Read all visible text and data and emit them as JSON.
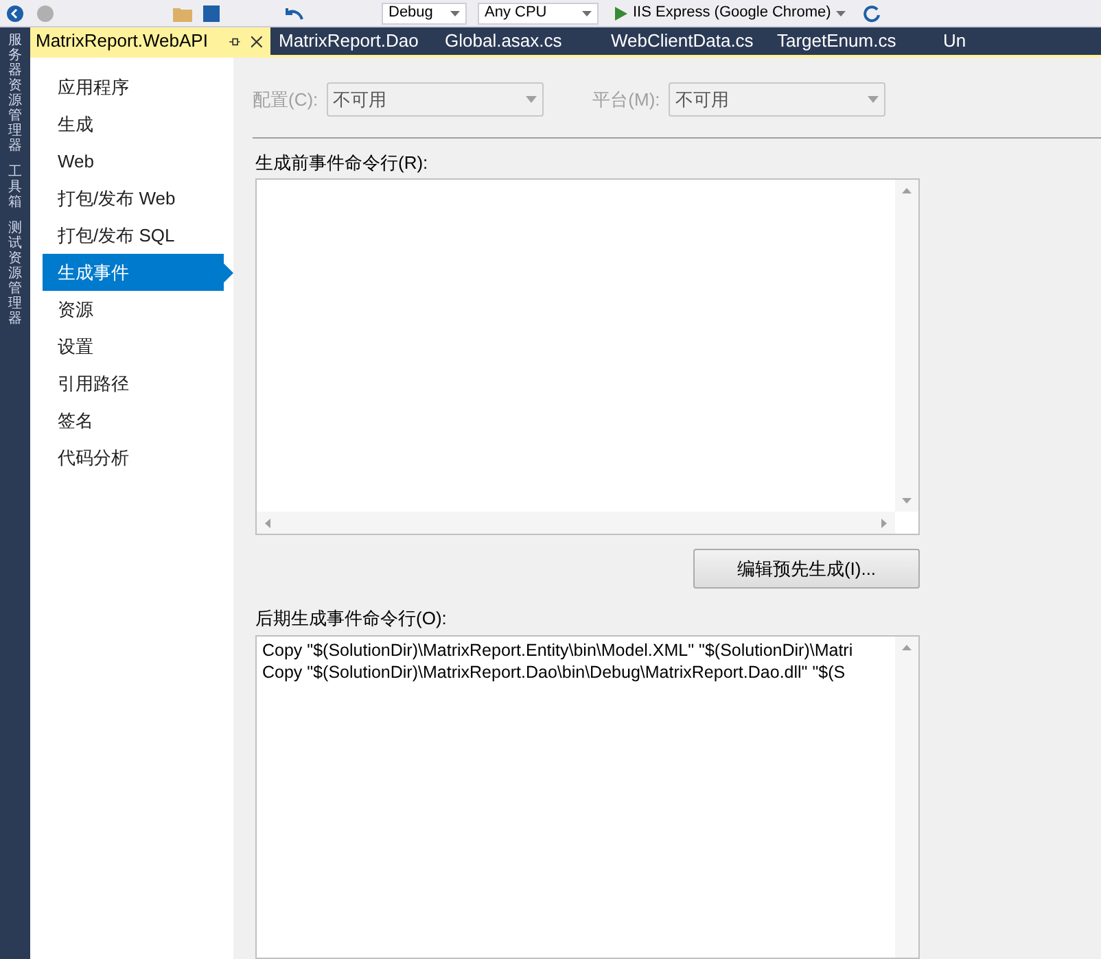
{
  "toolbar": {
    "configuration": "Debug",
    "platform": "Any CPU",
    "run_target": "IIS Express (Google Chrome)"
  },
  "side_panels": [
    "服务器资源管理器",
    "工具箱",
    "测试资源管理器"
  ],
  "tabs": [
    {
      "label": "MatrixReport.WebAPI",
      "selected": true
    },
    {
      "label": "MatrixReport.Dao",
      "selected": false
    },
    {
      "label": "Global.asax.cs",
      "selected": false
    },
    {
      "label": "WebClientData.cs",
      "selected": false
    },
    {
      "label": "TargetEnum.cs",
      "selected": false
    },
    {
      "label": "Un",
      "selected": false
    }
  ],
  "nav": [
    {
      "label": "应用程序",
      "selected": false
    },
    {
      "label": "生成",
      "selected": false
    },
    {
      "label": "Web",
      "selected": false
    },
    {
      "label": "打包/发布 Web",
      "selected": false
    },
    {
      "label": "打包/发布 SQL",
      "selected": false
    },
    {
      "label": "生成事件",
      "selected": true
    },
    {
      "label": "资源",
      "selected": false
    },
    {
      "label": "设置",
      "selected": false
    },
    {
      "label": "引用路径",
      "selected": false
    },
    {
      "label": "签名",
      "selected": false
    },
    {
      "label": "代码分析",
      "selected": false
    }
  ],
  "configuration": {
    "label": "配置(C):",
    "value": "不可用",
    "disabled": true
  },
  "platform": {
    "label": "平台(M):",
    "value": "不可用",
    "disabled": true
  },
  "pre_build": {
    "label": "生成前事件命令行(R):"
  },
  "edit_button": "编辑预先生成(I)...",
  "post_build": {
    "label": "后期生成事件命令行(O):",
    "lines": [
      "Copy \"$(SolutionDir)\\MatrixReport.Entity\\bin\\Model.XML\" \"$(SolutionDir)\\Matri",
      "Copy \"$(SolutionDir)\\MatrixReport.Dao\\bin\\Debug\\MatrixReport.Dao.dll\" \"$(S"
    ]
  }
}
